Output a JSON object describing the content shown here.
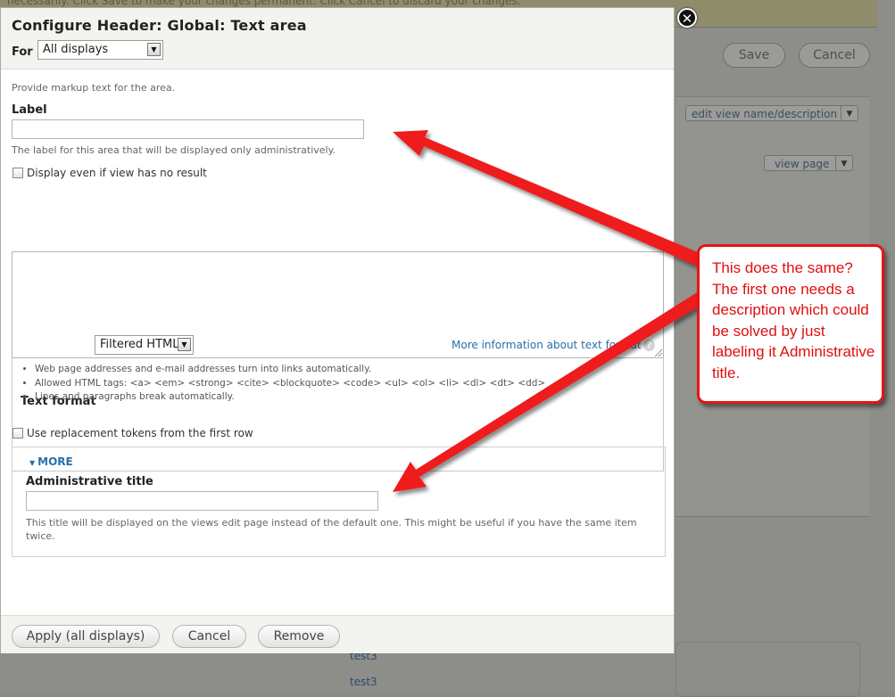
{
  "background": {
    "message": "necessarily. Click Save to make your changes permanent. Click Cancel to discard your changes.",
    "save_label": "Save",
    "cancel_label": "Cancel",
    "edit_view_dropdown": "edit view name/description",
    "view_page_dropdown": "view page",
    "list_items": [
      "test3",
      "test3"
    ]
  },
  "dialog": {
    "title": "Configure Header: Global: Text area",
    "for_label": "For",
    "for_select_value": "All displays",
    "intro": "Provide markup text for the area.",
    "label_field": {
      "label": "Label",
      "value": "",
      "description": "The label for this area that will be displayed only administratively."
    },
    "empty_checkbox_label": "Display even if view has no result",
    "text_format": {
      "label": "Text format",
      "selected": "Filtered HTML",
      "more_info_link": "More information about text formats",
      "tips": [
        "Web page addresses and e-mail addresses turn into links automatically.",
        "Allowed HTML tags: <a> <em> <strong> <cite> <blockquote> <code> <ul> <ol> <li> <dl> <dt> <dd>",
        "Lines and paragraphs break automatically."
      ]
    },
    "tokenize_label": "Use replacement tokens from the first row",
    "more": {
      "toggle": "MORE",
      "admin_title_label": "Administrative title",
      "admin_title_value": "",
      "admin_title_description": "This title will be displayed on the views edit page instead of the default one. This might be useful if you have the same item twice."
    },
    "buttons": {
      "apply": "Apply (all displays)",
      "cancel": "Cancel",
      "remove": "Remove"
    }
  },
  "annotation": {
    "text": "This does the same? The first one needs  a description which could be solved by just labeling it Administrative title.",
    "color": "#e61515"
  }
}
